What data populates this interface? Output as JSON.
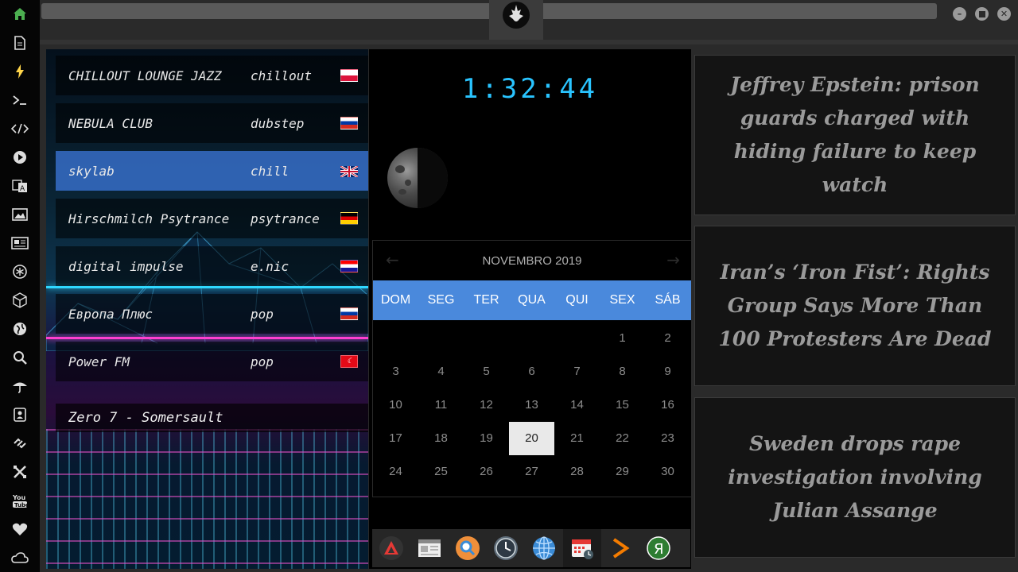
{
  "sidebar": {
    "icons": [
      "home-icon",
      "document-icon",
      "flash-icon",
      "terminal-icon",
      "code-icon",
      "play-icon",
      "translate-icon",
      "image-icon",
      "news-icon",
      "settings-circle-icon",
      "cube-icon",
      "globe-icon",
      "search-icon",
      "weather-icon",
      "contacts-icon",
      "link-icon",
      "tools-icon",
      "youtube-icon",
      "heart-icon",
      "cloud-icon"
    ]
  },
  "radio": {
    "stations": [
      {
        "name": "CHILLOUT LOUNGE JAZZ",
        "genre": "chillout",
        "flag": "poland"
      },
      {
        "name": "NEBULA CLUB",
        "genre": "dubstep",
        "flag": "russia"
      },
      {
        "name": "skylab",
        "genre": "chill",
        "flag": "uk"
      },
      {
        "name": "Hirschmilch Psytrance",
        "genre": "psytrance",
        "flag": "germany"
      },
      {
        "name": "digital impulse",
        "genre": "e.nic",
        "flag": "croatia"
      },
      {
        "name": "Европа Плюс",
        "genre": "pop",
        "flag": "russia"
      },
      {
        "name": "Power FM",
        "genre": "pop",
        "flag": "turkey"
      }
    ],
    "now_playing": "Zero 7 - Somersault",
    "active_index": 2
  },
  "clock": {
    "time": "1:32:44"
  },
  "calendar": {
    "month_label": "NOVEMBRO 2019",
    "weekdays": [
      "DOM",
      "SEG",
      "TER",
      "QUA",
      "QUI",
      "SEX",
      "SÁB"
    ],
    "weeks": [
      [
        "",
        "",
        "",
        "",
        "",
        "1",
        "2"
      ],
      [
        "3",
        "4",
        "5",
        "6",
        "7",
        "8",
        "9"
      ],
      [
        "10",
        "11",
        "12",
        "13",
        "14",
        "15",
        "16"
      ],
      [
        "17",
        "18",
        "19",
        "20",
        "21",
        "22",
        "23"
      ],
      [
        "24",
        "25",
        "26",
        "27",
        "28",
        "29",
        "30"
      ]
    ],
    "today": "20"
  },
  "dock": {
    "items": [
      "app-launcher-icon",
      "news-app-icon",
      "search-app-icon",
      "clock-app-icon",
      "browser-icon",
      "calendar-app-icon",
      "terminal-app-icon",
      "yandex-icon"
    ]
  },
  "news": {
    "headlines": [
      "Jeffrey Epstein: prison guards charged with hiding failure to keep watch",
      "Iran’s ‘Iron Fist’: Rights Group Says More Than 100 Protesters Are Dead",
      "Sweden drops rape investigation involving Julian Assange"
    ]
  },
  "colors": {
    "accent": "#4a89dc",
    "clock": "#29c4ff",
    "active_station": "#3c78dc"
  }
}
